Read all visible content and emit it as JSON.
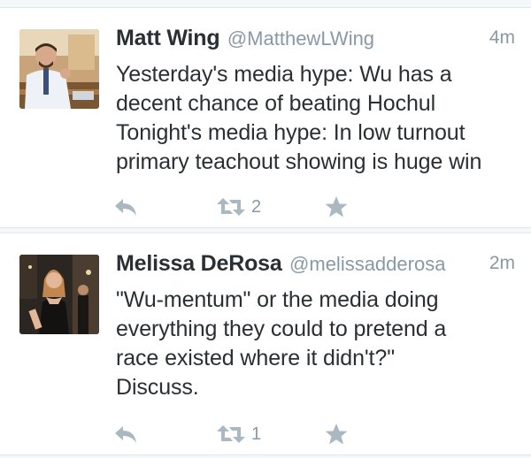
{
  "colors": {
    "page_background": "#f5f8fa",
    "card_background": "#ffffff",
    "name_text": "#292f33",
    "secondary_text": "#8899a6",
    "action_icon": "#aab8c2",
    "divider": "#e1e8ed"
  },
  "tweets": [
    {
      "name": "Matt Wing",
      "handle": "@MatthewLWing",
      "time": "4m",
      "text": "Yesterday's media hype: Wu has a\ndecent chance of beating Hochul\nTonight's media hype: In low turnout\nprimary teachout showing is huge win",
      "retweet_count": "2",
      "icons": [
        "reply-icon",
        "retweet-icon",
        "star-icon"
      ]
    },
    {
      "name": "Melissa DeRosa",
      "handle": "@melissadderosa",
      "time": "2m",
      "text": "\"Wu-mentum\" or the media doing\neverything they could to pretend a\nrace existed where it didn't?\"\nDiscuss.",
      "retweet_count": "1",
      "icons": [
        "reply-icon",
        "retweet-icon",
        "star-icon"
      ]
    }
  ]
}
